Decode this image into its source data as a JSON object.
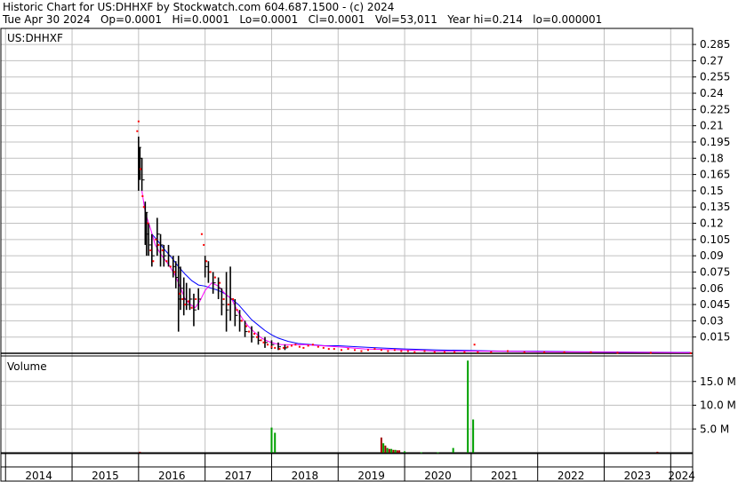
{
  "header": {
    "line1": "Historic Chart for US:DHHXF by Stockwatch.com 604.687.1500 - (c) 2024",
    "line2": "Tue Apr 30 2024   Op=0.0001   Hi=0.0001   Lo=0.0001   Cl=0.0001   Vol=53,011   Year hi=0.214   lo=0.000001"
  },
  "colors": {
    "price_bar": "#000000",
    "close_dot": "#ff0000",
    "ma_short": "#ff00ff",
    "ma_long": "#0000ff",
    "volume_up": "#00a000",
    "volume_down": "#a00000",
    "grid": "#c0c0c0",
    "baseline": "#000000"
  },
  "chart_data": [
    {
      "type": "line",
      "label": "US:DHHXF",
      "ylim": [
        0,
        0.29
      ],
      "y_ticks": [
        "0.285",
        "0.27",
        "0.255",
        "0.24",
        "0.225",
        "0.21",
        "0.195",
        "0.18",
        "0.165",
        "0.15",
        "0.135",
        "0.12",
        "0.105",
        "0.09",
        "0.075",
        "0.06",
        "0.045",
        "0.03",
        "0.015"
      ],
      "y_tick_values": [
        0.285,
        0.27,
        0.255,
        0.24,
        0.225,
        0.21,
        0.195,
        0.18,
        0.165,
        0.15,
        0.135,
        0.12,
        0.105,
        0.09,
        0.075,
        0.06,
        0.045,
        0.03,
        0.015
      ],
      "x_labels": [
        "2014",
        "2015",
        "2016",
        "2017",
        "2018",
        "2019",
        "2020",
        "2021",
        "2022",
        "2023",
        "2024"
      ],
      "xlim": [
        2013.93,
        2024.33
      ],
      "ohlc": [
        {
          "x": 2016.0,
          "hi": 0.2,
          "lo": 0.15,
          "cl": 0.19
        },
        {
          "x": 2016.02,
          "hi": 0.19,
          "lo": 0.16,
          "cl": 0.18
        },
        {
          "x": 2016.05,
          "hi": 0.18,
          "lo": 0.15,
          "cl": 0.16
        },
        {
          "x": 2016.1,
          "hi": 0.14,
          "lo": 0.1,
          "cl": 0.13
        },
        {
          "x": 2016.12,
          "hi": 0.13,
          "lo": 0.09,
          "cl": 0.11
        },
        {
          "x": 2016.15,
          "hi": 0.12,
          "lo": 0.09,
          "cl": 0.1
        },
        {
          "x": 2016.2,
          "hi": 0.11,
          "lo": 0.08,
          "cl": 0.09
        },
        {
          "x": 2016.28,
          "hi": 0.125,
          "lo": 0.09,
          "cl": 0.11
        },
        {
          "x": 2016.33,
          "hi": 0.11,
          "lo": 0.08,
          "cl": 0.1
        },
        {
          "x": 2016.38,
          "hi": 0.1,
          "lo": 0.08,
          "cl": 0.09
        },
        {
          "x": 2016.45,
          "hi": 0.1,
          "lo": 0.08,
          "cl": 0.09
        },
        {
          "x": 2016.52,
          "hi": 0.09,
          "lo": 0.07,
          "cl": 0.08
        },
        {
          "x": 2016.56,
          "hi": 0.085,
          "lo": 0.06,
          "cl": 0.07
        },
        {
          "x": 2016.6,
          "hi": 0.09,
          "lo": 0.02,
          "cl": 0.05
        },
        {
          "x": 2016.63,
          "hi": 0.08,
          "lo": 0.04,
          "cl": 0.06
        },
        {
          "x": 2016.68,
          "hi": 0.07,
          "lo": 0.035,
          "cl": 0.05
        },
        {
          "x": 2016.72,
          "hi": 0.065,
          "lo": 0.04,
          "cl": 0.045
        },
        {
          "x": 2016.77,
          "hi": 0.06,
          "lo": 0.04,
          "cl": 0.05
        },
        {
          "x": 2016.83,
          "hi": 0.055,
          "lo": 0.025,
          "cl": 0.04
        },
        {
          "x": 2016.9,
          "hi": 0.06,
          "lo": 0.04,
          "cl": 0.05
        },
        {
          "x": 2017.0,
          "hi": 0.09,
          "lo": 0.07,
          "cl": 0.08
        },
        {
          "x": 2017.05,
          "hi": 0.085,
          "lo": 0.065,
          "cl": 0.075
        },
        {
          "x": 2017.12,
          "hi": 0.075,
          "lo": 0.055,
          "cl": 0.065
        },
        {
          "x": 2017.2,
          "hi": 0.07,
          "lo": 0.05,
          "cl": 0.06
        },
        {
          "x": 2017.25,
          "hi": 0.06,
          "lo": 0.035,
          "cl": 0.045
        },
        {
          "x": 2017.32,
          "hi": 0.075,
          "lo": 0.02,
          "cl": 0.04
        },
        {
          "x": 2017.38,
          "hi": 0.08,
          "lo": 0.03,
          "cl": 0.05
        },
        {
          "x": 2017.45,
          "hi": 0.05,
          "lo": 0.025,
          "cl": 0.035
        },
        {
          "x": 2017.52,
          "hi": 0.04,
          "lo": 0.02,
          "cl": 0.03
        },
        {
          "x": 2017.6,
          "hi": 0.03,
          "lo": 0.015,
          "cl": 0.02
        },
        {
          "x": 2017.7,
          "hi": 0.025,
          "lo": 0.01,
          "cl": 0.015
        },
        {
          "x": 2017.8,
          "hi": 0.02,
          "lo": 0.008,
          "cl": 0.012
        },
        {
          "x": 2017.9,
          "hi": 0.015,
          "lo": 0.005,
          "cl": 0.01
        },
        {
          "x": 2018.0,
          "hi": 0.012,
          "lo": 0.004,
          "cl": 0.008
        },
        {
          "x": 2018.1,
          "hi": 0.01,
          "lo": 0.003,
          "cl": 0.006
        },
        {
          "x": 2018.2,
          "hi": 0.008,
          "lo": 0.003,
          "cl": 0.005
        }
      ],
      "close_dots": [
        {
          "x": 2015.98,
          "y": 0.205
        },
        {
          "x": 2016.0,
          "y": 0.214
        },
        {
          "x": 2016.03,
          "y": 0.17
        },
        {
          "x": 2016.06,
          "y": 0.145
        },
        {
          "x": 2016.08,
          "y": 0.135
        },
        {
          "x": 2016.14,
          "y": 0.12
        },
        {
          "x": 2016.18,
          "y": 0.095
        },
        {
          "x": 2016.22,
          "y": 0.085
        },
        {
          "x": 2016.26,
          "y": 0.105
        },
        {
          "x": 2016.3,
          "y": 0.1
        },
        {
          "x": 2016.36,
          "y": 0.095
        },
        {
          "x": 2016.42,
          "y": 0.085
        },
        {
          "x": 2016.48,
          "y": 0.08
        },
        {
          "x": 2016.54,
          "y": 0.075
        },
        {
          "x": 2016.62,
          "y": 0.055
        },
        {
          "x": 2016.66,
          "y": 0.05
        },
        {
          "x": 2016.7,
          "y": 0.045
        },
        {
          "x": 2016.75,
          "y": 0.048
        },
        {
          "x": 2016.8,
          "y": 0.042
        },
        {
          "x": 2016.86,
          "y": 0.05
        },
        {
          "x": 2016.95,
          "y": 0.11
        },
        {
          "x": 2016.98,
          "y": 0.1
        },
        {
          "x": 2017.02,
          "y": 0.085
        },
        {
          "x": 2017.08,
          "y": 0.075
        },
        {
          "x": 2017.15,
          "y": 0.07
        },
        {
          "x": 2017.22,
          "y": 0.065
        },
        {
          "x": 2017.28,
          "y": 0.05
        },
        {
          "x": 2017.35,
          "y": 0.045
        },
        {
          "x": 2017.42,
          "y": 0.05
        },
        {
          "x": 2017.48,
          "y": 0.04
        },
        {
          "x": 2017.55,
          "y": 0.03
        },
        {
          "x": 2017.62,
          "y": 0.025
        },
        {
          "x": 2017.66,
          "y": 0.02
        },
        {
          "x": 2017.74,
          "y": 0.018
        },
        {
          "x": 2017.78,
          "y": 0.015
        },
        {
          "x": 2017.84,
          "y": 0.012
        },
        {
          "x": 2017.88,
          "y": 0.01
        },
        {
          "x": 2017.94,
          "y": 0.008
        },
        {
          "x": 2018.0,
          "y": 0.006
        },
        {
          "x": 2018.05,
          "y": 0.005
        },
        {
          "x": 2018.12,
          "y": 0.004
        },
        {
          "x": 2018.18,
          "y": 0.005
        },
        {
          "x": 2018.24,
          "y": 0.006
        },
        {
          "x": 2018.3,
          "y": 0.007
        },
        {
          "x": 2018.36,
          "y": 0.008
        },
        {
          "x": 2018.42,
          "y": 0.006
        },
        {
          "x": 2018.48,
          "y": 0.005
        },
        {
          "x": 2018.55,
          "y": 0.007
        },
        {
          "x": 2018.62,
          "y": 0.008
        },
        {
          "x": 2018.7,
          "y": 0.006
        },
        {
          "x": 2018.78,
          "y": 0.005
        },
        {
          "x": 2018.86,
          "y": 0.004
        },
        {
          "x": 2018.94,
          "y": 0.004
        },
        {
          "x": 2019.05,
          "y": 0.003
        },
        {
          "x": 2019.15,
          "y": 0.004
        },
        {
          "x": 2019.25,
          "y": 0.003
        },
        {
          "x": 2019.35,
          "y": 0.002
        },
        {
          "x": 2019.45,
          "y": 0.003
        },
        {
          "x": 2019.55,
          "y": 0.004
        },
        {
          "x": 2019.65,
          "y": 0.003
        },
        {
          "x": 2019.75,
          "y": 0.002
        },
        {
          "x": 2019.85,
          "y": 0.003
        },
        {
          "x": 2019.95,
          "y": 0.002
        },
        {
          "x": 2020.05,
          "y": 0.002
        },
        {
          "x": 2020.15,
          "y": 0.001
        },
        {
          "x": 2020.3,
          "y": 0.002
        },
        {
          "x": 2020.45,
          "y": 0.001
        },
        {
          "x": 2020.6,
          "y": 0.001
        },
        {
          "x": 2020.75,
          "y": 0.001
        },
        {
          "x": 2020.9,
          "y": 0.001
        },
        {
          "x": 2021.05,
          "y": 0.008
        },
        {
          "x": 2021.1,
          "y": 0.001
        },
        {
          "x": 2021.3,
          "y": 0.001
        },
        {
          "x": 2021.55,
          "y": 0.002
        },
        {
          "x": 2021.8,
          "y": 0.001
        },
        {
          "x": 2022.1,
          "y": 0.001
        },
        {
          "x": 2022.4,
          "y": 0.001
        },
        {
          "x": 2022.8,
          "y": 0.001
        },
        {
          "x": 2023.2,
          "y": 0.0005
        },
        {
          "x": 2023.7,
          "y": 0.0005
        },
        {
          "x": 2024.3,
          "y": 0.0001
        }
      ],
      "series": [
        {
          "key": "ma_short",
          "x": [
            2016.05,
            2016.1,
            2016.18,
            2016.25,
            2016.35,
            2016.45,
            2016.55,
            2016.62,
            2016.7,
            2016.78,
            2016.85,
            2016.92,
            2017.0,
            2017.1,
            2017.2,
            2017.3,
            2017.4,
            2017.48,
            2017.56,
            2017.65,
            2017.75,
            2017.85,
            2017.95,
            2018.05,
            2018.15,
            2018.3,
            2018.5,
            2018.75,
            2019.0,
            2019.4,
            2020.0,
            2020.5,
            2021.0,
            2021.5,
            2022.0,
            2022.5,
            2023.0,
            2023.5,
            2024.3
          ],
          "y": [
            0.15,
            0.13,
            0.115,
            0.1,
            0.09,
            0.082,
            0.072,
            0.062,
            0.05,
            0.045,
            0.042,
            0.048,
            0.058,
            0.065,
            0.062,
            0.055,
            0.05,
            0.04,
            0.032,
            0.025,
            0.019,
            0.014,
            0.011,
            0.009,
            0.008,
            0.008,
            0.008,
            0.007,
            0.006,
            0.004,
            0.003,
            0.002,
            0.002,
            0.0018,
            0.0015,
            0.0012,
            0.001,
            0.0008,
            0.0005
          ]
        },
        {
          "key": "ma_long",
          "x": [
            2016.2,
            2016.3,
            2016.4,
            2016.5,
            2016.6,
            2016.7,
            2016.8,
            2016.9,
            2017.0,
            2017.1,
            2017.2,
            2017.3,
            2017.4,
            2017.5,
            2017.6,
            2017.7,
            2017.8,
            2017.9,
            2018.0,
            2018.1,
            2018.25,
            2018.4,
            2018.6,
            2018.8,
            2019.0,
            2019.3,
            2019.6,
            2020.0,
            2020.5,
            2021.0,
            2021.5,
            2022.0,
            2022.5,
            2023.0,
            2023.5,
            2024.3
          ],
          "y": [
            0.11,
            0.103,
            0.095,
            0.088,
            0.08,
            0.073,
            0.067,
            0.063,
            0.062,
            0.06,
            0.058,
            0.055,
            0.05,
            0.045,
            0.038,
            0.031,
            0.026,
            0.021,
            0.017,
            0.014,
            0.011,
            0.009,
            0.008,
            0.007,
            0.007,
            0.006,
            0.005,
            0.004,
            0.003,
            0.0025,
            0.002,
            0.0018,
            0.0015,
            0.0012,
            0.001,
            0.0008
          ]
        }
      ]
    },
    {
      "type": "bar",
      "label": "Volume",
      "ylim": [
        0,
        20
      ],
      "y_ticks": [
        "15.0 M",
        "10.0 M",
        "5.0 M"
      ],
      "y_tick_values": [
        15,
        10,
        5
      ],
      "bars": [
        {
          "x": 2016.02,
          "v": 0.2,
          "up": false
        },
        {
          "x": 2018.0,
          "v": 5.3,
          "up": true
        },
        {
          "x": 2018.05,
          "v": 4.2,
          "up": true
        },
        {
          "x": 2019.65,
          "v": 3.2,
          "up": false
        },
        {
          "x": 2019.68,
          "v": 2.0,
          "up": true
        },
        {
          "x": 2019.71,
          "v": 1.5,
          "up": false
        },
        {
          "x": 2019.74,
          "v": 1.0,
          "up": true
        },
        {
          "x": 2019.77,
          "v": 0.8,
          "up": false
        },
        {
          "x": 2019.8,
          "v": 0.8,
          "up": true
        },
        {
          "x": 2019.83,
          "v": 0.6,
          "up": false
        },
        {
          "x": 2019.86,
          "v": 0.6,
          "up": true
        },
        {
          "x": 2019.89,
          "v": 0.5,
          "up": false
        },
        {
          "x": 2019.92,
          "v": 0.5,
          "up": false
        },
        {
          "x": 2020.0,
          "v": 0.3,
          "up": true
        },
        {
          "x": 2020.25,
          "v": 0.1,
          "up": true
        },
        {
          "x": 2020.5,
          "v": 0.1,
          "up": true
        },
        {
          "x": 2020.73,
          "v": 1.0,
          "up": true
        },
        {
          "x": 2020.95,
          "v": 19.4,
          "up": true
        },
        {
          "x": 2021.03,
          "v": 7.0,
          "up": true
        },
        {
          "x": 2023.8,
          "v": 0.2,
          "up": false
        }
      ]
    }
  ]
}
